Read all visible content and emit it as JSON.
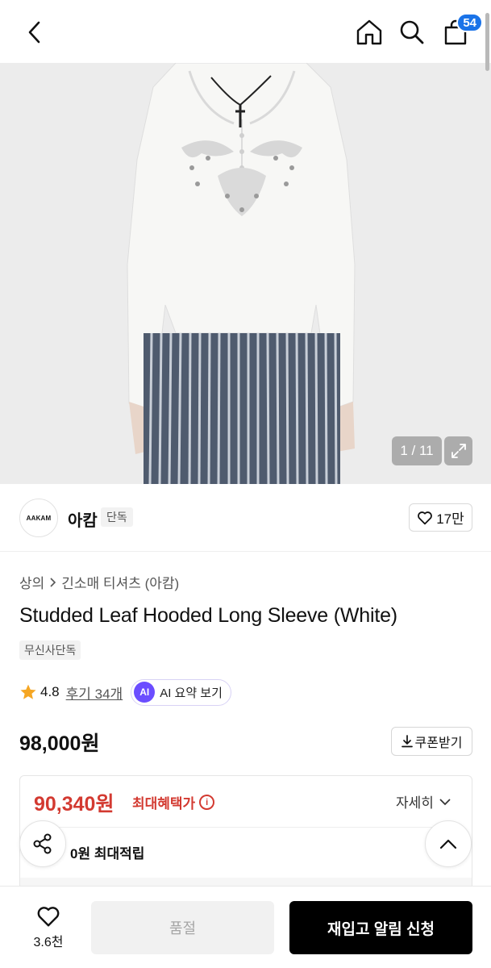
{
  "header": {
    "back_icon": "chevron-left-icon",
    "home_icon": "home-icon",
    "search_icon": "search-icon",
    "cart_icon": "bag-icon",
    "cart_count": "54"
  },
  "gallery": {
    "pager": "1 / 11",
    "expand_icon": "expand-icon"
  },
  "brand": {
    "logo_text": "AAKAM",
    "name": "아캄",
    "tag": "단독",
    "like_count": "17만"
  },
  "product": {
    "breadcrumb": [
      "상의",
      "긴소매 티셔츠 (아캄)"
    ],
    "title": "Studded Leaf Hooded Long Sleeve (White)",
    "exclusive_chip": "무신사단독",
    "rating": "4.8",
    "reviews": "후기 34개",
    "ai_badge": "AI",
    "ai_summary": "AI 요약 보기",
    "price": "98,000원",
    "coupon": "쿠폰받기"
  },
  "benefit": {
    "max_price": "90,340원",
    "max_label": "최대혜택가",
    "detail": "자세히",
    "points": "0원 최대적립"
  },
  "bottom": {
    "wish_count": "3.6천",
    "soldout": "품절",
    "restock": "재입고 알림 신청"
  },
  "colors": {
    "accent_red": "#d33a31",
    "badge_blue": "#1a73e8",
    "ai_purple": "#6b4dff"
  }
}
